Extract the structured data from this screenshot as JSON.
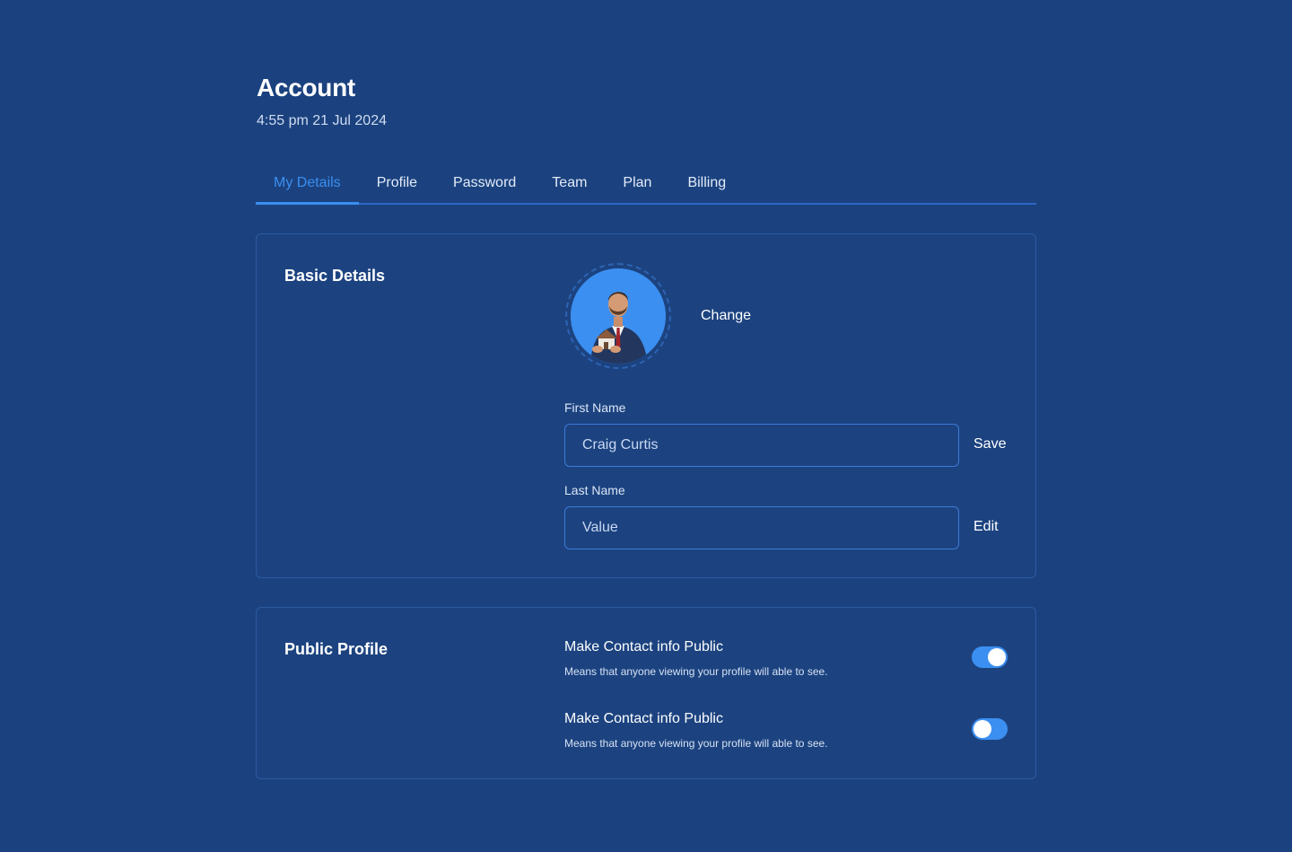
{
  "header": {
    "title": "Account",
    "datetime": "4:55 pm 21 Jul 2024"
  },
  "tabs": [
    {
      "label": "My Details",
      "active": true
    },
    {
      "label": "Profile",
      "active": false
    },
    {
      "label": "Password",
      "active": false
    },
    {
      "label": "Team",
      "active": false
    },
    {
      "label": "Plan",
      "active": false
    },
    {
      "label": "Billing",
      "active": false
    }
  ],
  "basic_details": {
    "title": "Basic Details",
    "change_label": "Change",
    "first_name": {
      "label": "First Name",
      "value": "Craig Curtis",
      "action": "Save"
    },
    "last_name": {
      "label": "Last Name",
      "placeholder": "Value",
      "action": "Edit"
    }
  },
  "public_profile": {
    "title": "Public Profile",
    "prefs": [
      {
        "title": "Make Contact info Public",
        "desc": "Means that anyone viewing your profile will able to see.",
        "enabled": true
      },
      {
        "title": "Make Contact info Public",
        "desc": "Means that anyone viewing your profile will able to see.",
        "enabled": false
      }
    ]
  },
  "colors": {
    "background": "#1b427f",
    "accent": "#3b8ff0",
    "border": "#2d5aa0"
  },
  "icons": {
    "avatar": "user-photo"
  }
}
